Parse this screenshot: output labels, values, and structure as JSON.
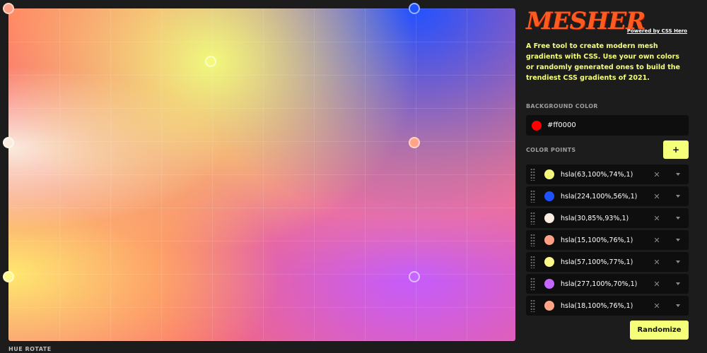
{
  "header": {
    "logo_text": "MESHER",
    "powered_by": "Powered by CSS Hero",
    "tagline": "A Free tool to create modern mesh gradients with CSS. Use your own colors or randomly generated ones to build the trendiest CSS gradients of 2021."
  },
  "background": {
    "label": "BACKGROUND COLOR",
    "value": "#ff0000",
    "color": "#ff0000"
  },
  "color_points": {
    "label": "COLOR POINTS",
    "add_label": "+",
    "items": [
      {
        "value": "hsla(63,100%,74%,1)",
        "color": "#f5f87b"
      },
      {
        "value": "hsla(224,100%,56%,1)",
        "color": "#1f52ff"
      },
      {
        "value": "hsla(30,85%,93%,1)",
        "color": "#fbeddf"
      },
      {
        "value": "hsla(15,100%,76%,1)",
        "color": "#ff9f85"
      },
      {
        "value": "hsla(57,100%,77%,1)",
        "color": "#fff88a"
      },
      {
        "value": "hsla(277,100%,70%,1)",
        "color": "#c466ff"
      },
      {
        "value": "hsla(18,100%,76%,1)",
        "color": "#ffa485"
      }
    ]
  },
  "canvas": {
    "handles": [
      {
        "color": "#ff9f85"
      },
      {
        "color": "#1f52ff"
      },
      {
        "color": "#f5f87b"
      },
      {
        "color": "#fbeddf"
      },
      {
        "color": "#ffa485"
      },
      {
        "color": "#fff88a"
      },
      {
        "color": "#c466ff"
      }
    ]
  },
  "actions": {
    "randomize_label": "Randomize",
    "hue_rotate_label": "HUE ROTATE"
  }
}
